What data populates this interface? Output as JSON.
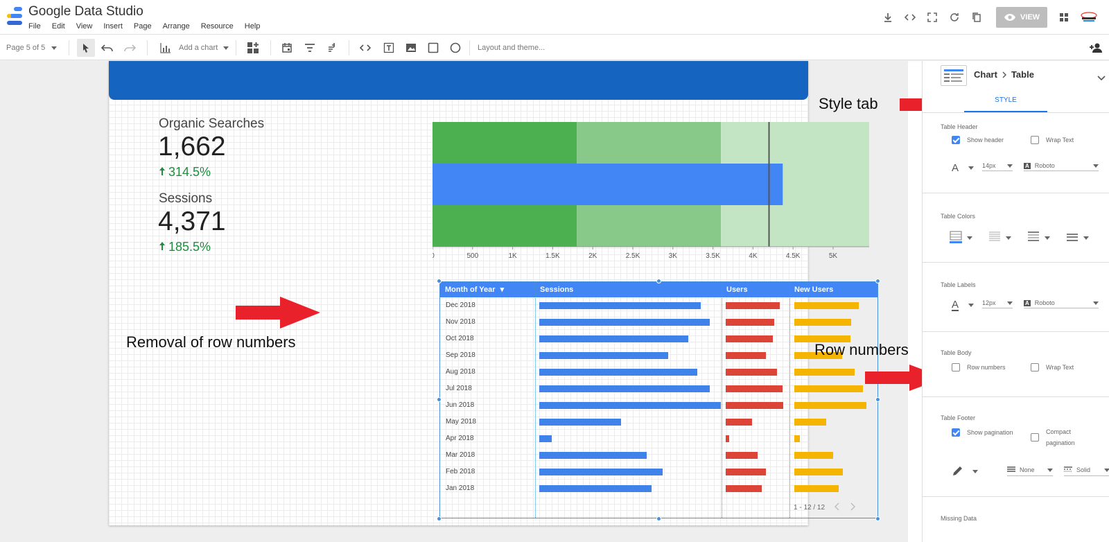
{
  "app": {
    "title": "Google Data Studio"
  },
  "menu": [
    "File",
    "Edit",
    "View",
    "Insert",
    "Page",
    "Arrange",
    "Resource",
    "Help"
  ],
  "header": {
    "view_label": "VIEW",
    "brand_icon": "brand-logo-icon"
  },
  "toolbar": {
    "page_selector": "Page 5 of 5",
    "add_chart": "Add a chart",
    "layout_theme": "Layout and theme..."
  },
  "scorecards": [
    {
      "label": "Organic Searches",
      "value": "1,662",
      "delta": "314.5%"
    },
    {
      "label": "Sessions",
      "value": "4,371",
      "delta": "185.5%"
    }
  ],
  "bullet": {
    "ticks": [
      "0",
      "500",
      "1K",
      "1.5K",
      "2K",
      "2.5K",
      "3K",
      "3.5K",
      "4K",
      "4.5K",
      "5K"
    ],
    "max": 5450,
    "ranges": [
      1800,
      3600,
      5450
    ],
    "target": 4200,
    "actual": 4371,
    "colors": {
      "range1": "#4caf50",
      "range2": "#88c98a",
      "range3": "#c3e5c4",
      "bar": "#4285f4",
      "target": "#555555"
    }
  },
  "table": {
    "columns": [
      "Month of Year",
      "Sessions",
      "Users",
      "New Users"
    ],
    "sort_indicator": "▾",
    "rows": [
      {
        "month": "Dec 2018",
        "sessions": 0.89,
        "users": 0.97,
        "new_users": 0.86
      },
      {
        "month": "Nov 2018",
        "sessions": 0.94,
        "users": 0.87,
        "new_users": 0.76
      },
      {
        "month": "Oct 2018",
        "sessions": 0.82,
        "users": 0.85,
        "new_users": 0.75
      },
      {
        "month": "Sep 2018",
        "sessions": 0.71,
        "users": 0.72,
        "new_users": 0.64
      },
      {
        "month": "Aug 2018",
        "sessions": 0.87,
        "users": 0.92,
        "new_users": 0.81
      },
      {
        "month": "Jul 2018",
        "sessions": 0.94,
        "users": 1.02,
        "new_users": 0.92
      },
      {
        "month": "Jun 2018",
        "sessions": 1.0,
        "users": 1.04,
        "new_users": 0.96
      },
      {
        "month": "May 2018",
        "sessions": 0.45,
        "users": 0.47,
        "new_users": 0.43
      },
      {
        "month": "Apr 2018",
        "sessions": 0.07,
        "users": 0.06,
        "new_users": 0.07
      },
      {
        "month": "Mar 2018",
        "sessions": 0.59,
        "users": 0.58,
        "new_users": 0.52
      },
      {
        "month": "Feb 2018",
        "sessions": 0.68,
        "users": 0.73,
        "new_users": 0.65
      },
      {
        "month": "Jan 2018",
        "sessions": 0.62,
        "users": 0.65,
        "new_users": 0.59
      }
    ],
    "pagination": "1 - 12 / 12",
    "colors": {
      "sessions": "#3e82ea",
      "users": "#db4437",
      "new_users": "#f4b400",
      "header": "#4285f4"
    }
  },
  "annotations": {
    "style_tab": "Style tab",
    "removal": "Removal of row numbers",
    "row_numbers": "Row numbers",
    "arrow_color": "#e8212b"
  },
  "panel": {
    "breadcrumb_parent": "Chart",
    "breadcrumb_child": "Table",
    "tab": "STYLE",
    "table_header": {
      "title": "Table Header",
      "show_header": "Show header",
      "wrap_text": "Wrap Text",
      "font_size": "14px",
      "font": "Roboto"
    },
    "table_colors": {
      "title": "Table Colors"
    },
    "table_labels": {
      "title": "Table Labels",
      "font_size": "12px",
      "font": "Roboto"
    },
    "table_body": {
      "title": "Table Body",
      "row_numbers": "Row numbers",
      "wrap_text": "Wrap Text"
    },
    "table_footer": {
      "title": "Table Footer",
      "show_pagination": "Show pagination",
      "compact_line1": "Compact",
      "compact_line2": "pagination",
      "border_style": "None",
      "line_style": "Solid"
    },
    "missing_data": {
      "title": "Missing Data"
    }
  }
}
